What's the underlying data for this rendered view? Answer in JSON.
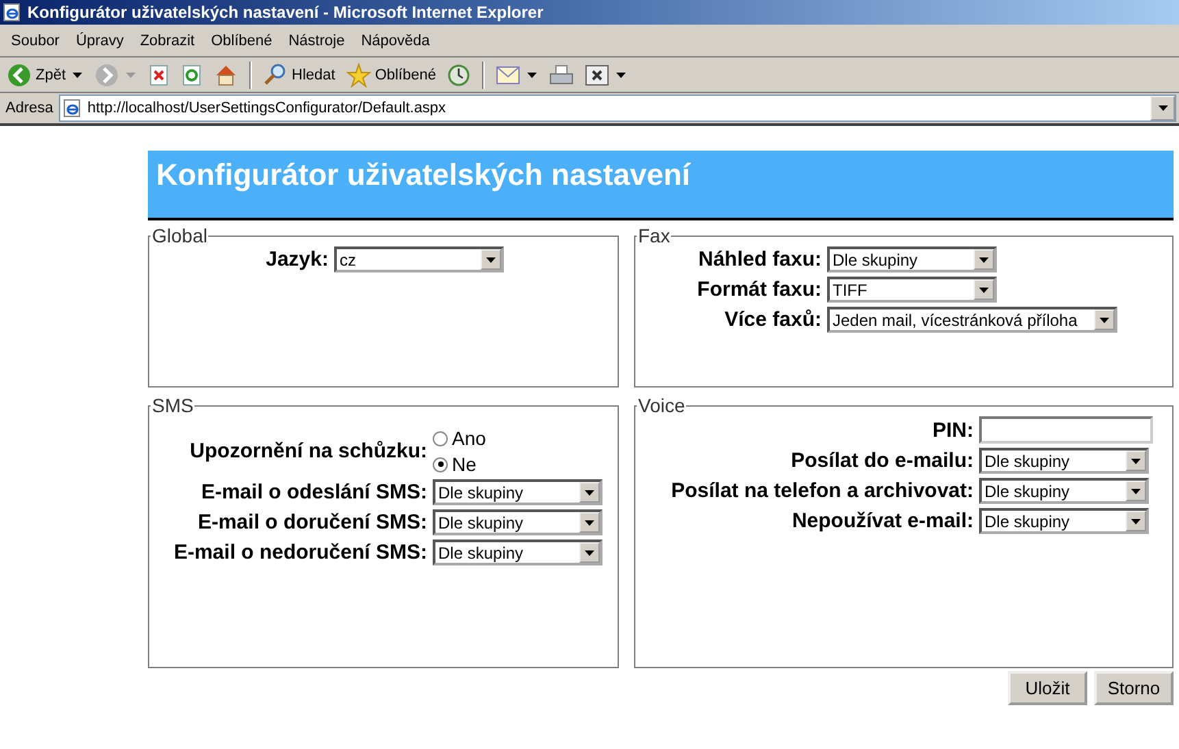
{
  "window": {
    "title": "Konfigurátor uživatelských nastavení - Microsoft Internet Explorer"
  },
  "menu": [
    "Soubor",
    "Úpravy",
    "Zobrazit",
    "Oblíbené",
    "Nástroje",
    "Nápověda"
  ],
  "toolbar": [
    {
      "kind": "back",
      "label": "Zpět"
    },
    {
      "kind": "forward"
    },
    {
      "kind": "stop"
    },
    {
      "kind": "refresh"
    },
    {
      "kind": "home"
    },
    {
      "kind": "search",
      "label": "Hledat"
    },
    {
      "kind": "favorites",
      "label": "Oblíbené"
    },
    {
      "kind": "history"
    },
    {
      "kind": "mail"
    },
    {
      "kind": "print"
    },
    {
      "kind": "edit"
    }
  ],
  "address": {
    "label": "Adresa",
    "url": "http://localhost/UserSettingsConfigurator/Default.aspx"
  },
  "page": {
    "heading": "Konfigurátor uživatelských nastavení"
  },
  "panels": [
    {
      "legend": "Global",
      "fields": [
        {
          "kind": "select",
          "label": "Jazyk:",
          "value": "cz"
        }
      ]
    },
    {
      "legend": "Fax",
      "fields": [
        {
          "kind": "select",
          "label": "Náhled faxu:",
          "value": "Dle skupiny"
        },
        {
          "kind": "select",
          "label": "Formát faxu:",
          "value": "TIFF"
        },
        {
          "kind": "select",
          "label": "Více faxů:",
          "value": "Jeden mail, vícestránková příloha",
          "wide": true
        }
      ]
    },
    {
      "legend": "SMS",
      "fields": [
        {
          "kind": "radio",
          "label": "Upozornění na schůzku:",
          "options": [
            {
              "label": "Ano",
              "selected": false
            },
            {
              "label": "Ne",
              "selected": true
            }
          ]
        },
        {
          "kind": "select",
          "label": "E-mail o odeslání SMS:",
          "value": "Dle skupiny"
        },
        {
          "kind": "select",
          "label": "E-mail o doručení SMS:",
          "value": "Dle skupiny"
        },
        {
          "kind": "select",
          "label": "E-mail o nedoručení SMS:",
          "value": "Dle skupiny"
        }
      ]
    },
    {
      "legend": "Voice",
      "fields": [
        {
          "kind": "text",
          "label": "PIN:"
        },
        {
          "kind": "select",
          "label": "Posílat do e-mailu:",
          "value": "Dle skupiny"
        },
        {
          "kind": "select",
          "label": "Posílat na telefon a archivovat:",
          "value": "Dle skupiny"
        },
        {
          "kind": "select",
          "label": "Nepoužívat e-mail:",
          "value": "Dle skupiny"
        }
      ]
    }
  ],
  "buttons": [
    "Uložit",
    "Storno"
  ]
}
